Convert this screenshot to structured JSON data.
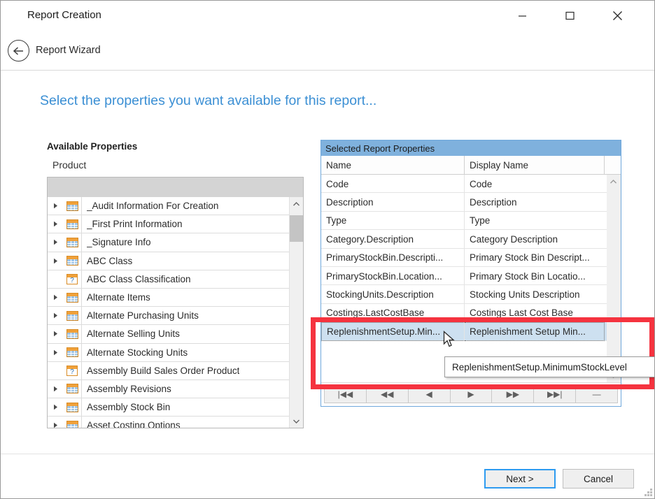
{
  "window": {
    "title": "Report Creation",
    "controls": {
      "minimize": "minimize-icon",
      "maximize": "maximize-icon",
      "close": "close-icon"
    }
  },
  "subheader": {
    "back_icon": "back-arrow-circle-icon",
    "label": "Report Wizard"
  },
  "page": {
    "heading": "Select the properties you want available for this report...",
    "heading_color": "#3b8fd4"
  },
  "available": {
    "title": "Available Properties",
    "subtitle": "Product",
    "items": [
      {
        "label": "_Audit Information For Creation",
        "icon": "grid-table-icon",
        "expandable": true
      },
      {
        "label": "_First Print Information",
        "icon": "grid-table-icon",
        "expandable": true
      },
      {
        "label": "_Signature Info",
        "icon": "grid-table-icon",
        "expandable": true
      },
      {
        "label": "ABC Class",
        "icon": "grid-table-icon",
        "expandable": true
      },
      {
        "label": "ABC Class Classification",
        "icon": "question-field-icon",
        "expandable": false
      },
      {
        "label": "Alternate Items",
        "icon": "grid-table-icon",
        "expandable": true
      },
      {
        "label": "Alternate Purchasing Units",
        "icon": "grid-table-icon",
        "expandable": true
      },
      {
        "label": "Alternate Selling Units",
        "icon": "grid-table-icon",
        "expandable": true
      },
      {
        "label": "Alternate Stocking Units",
        "icon": "grid-table-icon",
        "expandable": true
      },
      {
        "label": "Assembly Build Sales Order Product",
        "icon": "question-field-icon",
        "expandable": false
      },
      {
        "label": "Assembly Revisions",
        "icon": "grid-table-icon",
        "expandable": true
      },
      {
        "label": "Assembly Stock Bin",
        "icon": "grid-table-icon",
        "expandable": true
      },
      {
        "label": "Asset Costing Options",
        "icon": "grid-table-icon",
        "expandable": true
      }
    ]
  },
  "selected_grid": {
    "caption": "Selected Report Properties",
    "caption_bg": "#7fb1dd",
    "columns": [
      "Name",
      "Display Name"
    ],
    "rows": [
      {
        "name": "Code",
        "display": "Code",
        "selected": false
      },
      {
        "name": "Description",
        "display": "Description",
        "selected": false
      },
      {
        "name": "Type",
        "display": "Type",
        "selected": false
      },
      {
        "name": "Category.Description",
        "display": "Category Description",
        "selected": false
      },
      {
        "name": "PrimaryStockBin.Descripti...",
        "display": "Primary Stock Bin Descript...",
        "selected": false
      },
      {
        "name": "PrimaryStockBin.Location...",
        "display": "Primary Stock Bin Locatio...",
        "selected": false
      },
      {
        "name": "StockingUnits.Description",
        "display": "Stocking Units Description",
        "selected": false
      },
      {
        "name": "Costings.LastCostBase",
        "display": "Costings Last Cost Base",
        "selected": false
      },
      {
        "name": "ReplenishmentSetup.Min...",
        "display": "Replenishment Setup Min...",
        "selected": true
      }
    ],
    "selection_color": "#cde0f0",
    "navigator": [
      {
        "label": "|◀◀",
        "name": "nav-first"
      },
      {
        "label": "◀◀",
        "name": "nav-prev-page"
      },
      {
        "label": "◀",
        "name": "nav-prev"
      },
      {
        "label": "▶",
        "name": "nav-next"
      },
      {
        "label": "▶▶",
        "name": "nav-next-page"
      },
      {
        "label": "▶▶|",
        "name": "nav-last"
      },
      {
        "label": "—",
        "name": "nav-delete"
      }
    ]
  },
  "tooltip": {
    "text": "ReplenishmentSetup.MinimumStockLevel"
  },
  "annotation": {
    "color": "#f5333f"
  },
  "footer": {
    "next_label": "Next >",
    "cancel_label": "Cancel"
  }
}
